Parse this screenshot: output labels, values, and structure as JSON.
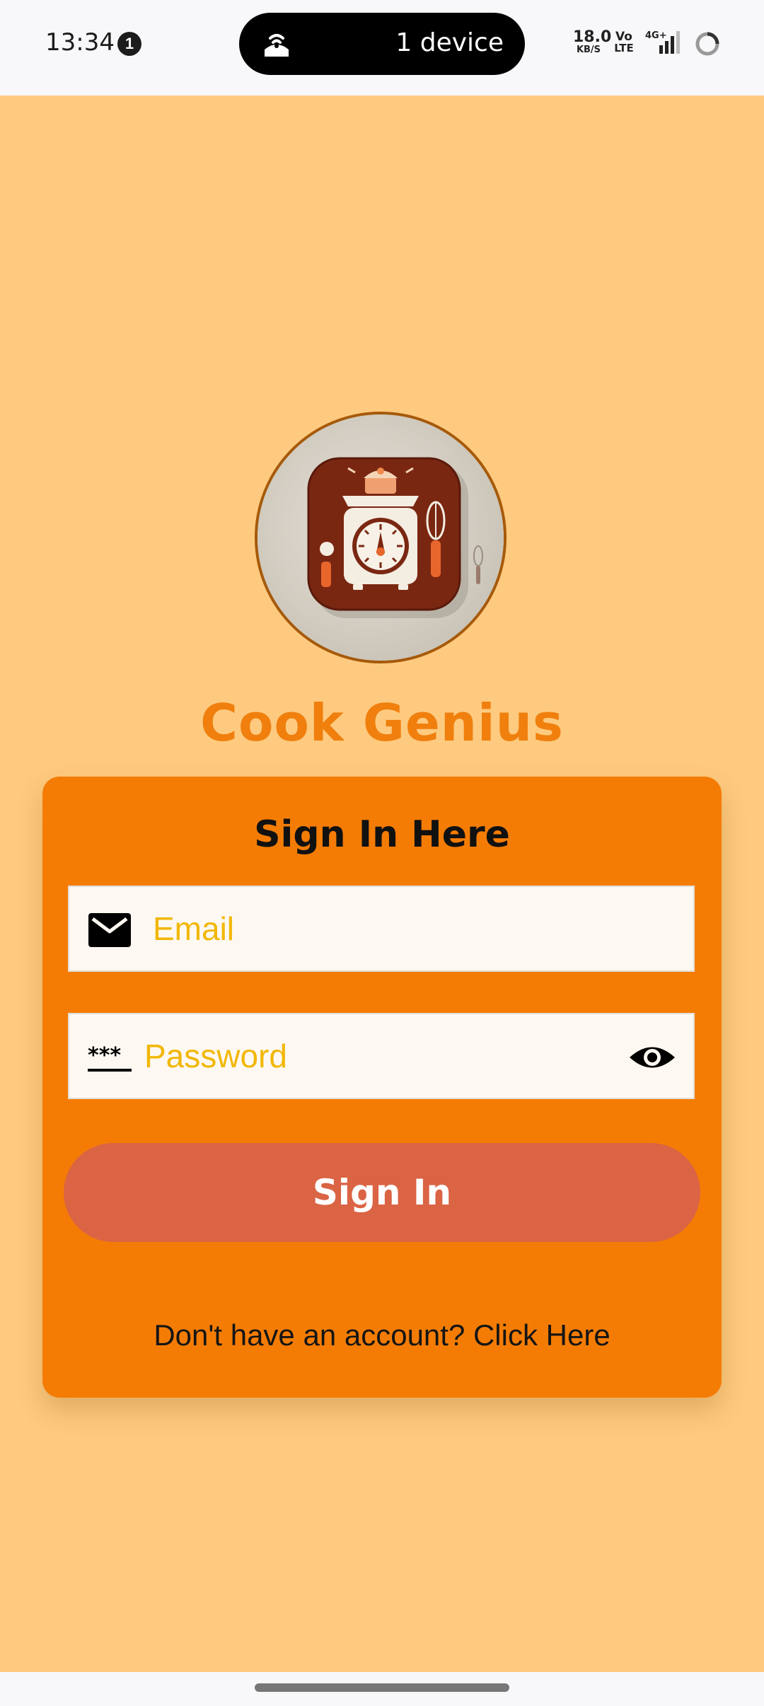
{
  "status_bar": {
    "time": "13:34",
    "notification_count": "1",
    "hotspot_label": "1 device",
    "speed_value": "18.0",
    "speed_unit": "KB/S",
    "volte_top": "Vo",
    "volte_bottom": "LTE",
    "network_type": "4G+",
    "icons": [
      "hotspot-icon",
      "signal-icon",
      "battery-icon"
    ]
  },
  "app": {
    "name": "Cook Genius",
    "logo_icon": "kitchen-scale-logo"
  },
  "form": {
    "title": "Sign In Here",
    "email": {
      "placeholder": "Email",
      "value": "",
      "icon": "mail-icon"
    },
    "password": {
      "placeholder": "Password",
      "value": "",
      "icon": "password-icon",
      "toggle_icon": "eye-icon"
    },
    "submit_label": "Sign In",
    "signup_prompt": "Don't have an account? Click Here"
  },
  "colors": {
    "background": "#FECA7F",
    "card": "#F47C05",
    "title": "#F07F0D",
    "button": "#DA6444",
    "placeholder": "#F2B705"
  }
}
